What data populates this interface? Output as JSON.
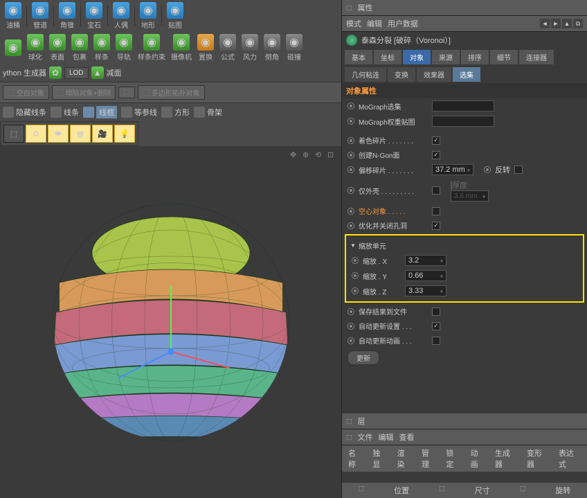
{
  "top_tools": [
    {
      "label": "油桶",
      "c": "blue"
    },
    {
      "label": "管道",
      "c": "blue"
    },
    {
      "label": "角锥",
      "c": "blue"
    },
    {
      "label": "宝石",
      "c": "blue"
    },
    {
      "label": "人偶",
      "c": "blue"
    },
    {
      "label": "地形",
      "c": "blue"
    },
    {
      "label": "贴图",
      "c": "blue"
    }
  ],
  "row2_tools": [
    {
      "label": "",
      "c": "green"
    },
    {
      "label": "球化",
      "c": "green"
    },
    {
      "label": "表面",
      "c": "green"
    },
    {
      "label": "包裹",
      "c": "green"
    },
    {
      "label": "样条",
      "c": "green"
    },
    {
      "label": "导轨",
      "c": "green"
    },
    {
      "label": "样条约束",
      "c": "green"
    },
    {
      "label": "摄像机",
      "c": "green"
    },
    {
      "label": "置换",
      "c": "orange"
    },
    {
      "label": "公式",
      "c": "gray"
    },
    {
      "label": "风力",
      "c": "gray"
    },
    {
      "label": "倒角",
      "c": "gray"
    },
    {
      "label": "碰撞",
      "c": "gray"
    }
  ],
  "row3": {
    "python": "ython 生成器",
    "lod": "LOD",
    "reduce": "减面"
  },
  "row4_btns": [
    "空白对象",
    "塌陷对象+删除",
    "",
    "多边形拓扑对象"
  ],
  "mode_row": [
    "隐藏线条",
    "线条",
    "线框",
    "等参线",
    "方形",
    "骨架"
  ],
  "mode_active_index": 2,
  "panel_title": "属性",
  "panel_menu": [
    "模式",
    "编辑",
    "用户数据"
  ],
  "obj_title": "泰森分裂 [破碎（Voronoi）]",
  "tabs_main": [
    "基本",
    "坐标",
    "对象",
    "来源",
    "排序",
    "细节",
    "连接器"
  ],
  "tabs_main_active": 2,
  "tabs_sub": [
    "几何粘连",
    "变换",
    "效果器",
    "选集"
  ],
  "tabs_sub_active": 3,
  "section1": "对象属性",
  "props_top": [
    {
      "label": "MoGraph选集",
      "type": "input",
      "val": ""
    },
    {
      "label": "MoGraph权重贴图",
      "type": "input",
      "val": ""
    }
  ],
  "props_mid": [
    {
      "label": "着色碎片 . . . . . . .",
      "type": "check",
      "checked": true
    },
    {
      "label": "创建N-Gon面",
      "type": "check",
      "checked": true
    },
    {
      "label": "偏移碎片 . . . . . . .",
      "type": "spinner",
      "val": "37.2 mm",
      "extra_label": "反转",
      "extra_check": false,
      "extra_radio": true
    },
    {
      "label": "仅外壳 . . . . . . . . .",
      "type": "check",
      "checked": false,
      "dim_extra": {
        "label": "厚度",
        "val": "3.6 mm"
      }
    },
    {
      "label": "空心对象 . . . . .",
      "type": "check",
      "checked": false,
      "orange": true
    },
    {
      "label": "优化并关闭孔洞",
      "type": "check",
      "checked": true
    }
  ],
  "scale_section": "缩放单元",
  "scale_rows": [
    {
      "label": "缩放 . X",
      "val": "3.2"
    },
    {
      "label": "缩放 . Y",
      "val": "0.66"
    },
    {
      "label": "缩放 . Z",
      "val": "3.33"
    }
  ],
  "props_bottom": [
    {
      "label": "保存结果到文件",
      "type": "check",
      "checked": false
    },
    {
      "label": "自动更新设置 . . .",
      "type": "check",
      "checked": true
    },
    {
      "label": "自动更新动画 . . .",
      "type": "check",
      "checked": false
    }
  ],
  "btn_update": "更新",
  "layer_title": "层",
  "layer_menu": [
    "文件",
    "编辑",
    "查看"
  ],
  "layer_cols": [
    "名称",
    "独显",
    "渲染",
    "管理",
    "锁定",
    "动画",
    "生成器",
    "变形器",
    "表达式"
  ],
  "footer": [
    "位置",
    "尺寸",
    "旋转"
  ]
}
